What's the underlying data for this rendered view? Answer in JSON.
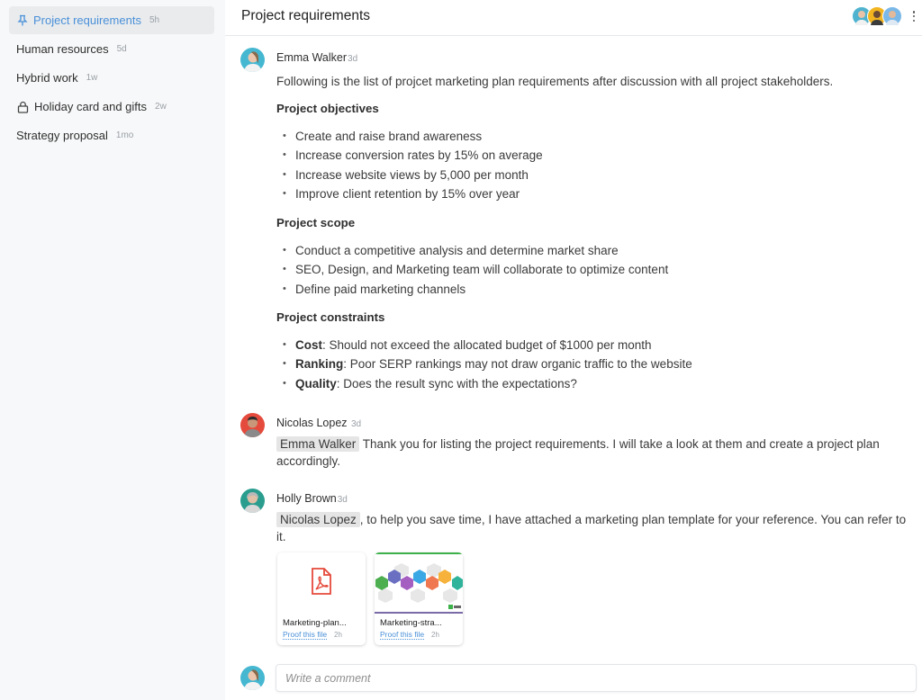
{
  "sidebar": {
    "items": [
      {
        "label": "Project requirements",
        "age": "5h",
        "icon": "pin-icon",
        "active": true
      },
      {
        "label": "Human resources",
        "age": "5d"
      },
      {
        "label": "Hybrid work",
        "age": "1w"
      },
      {
        "label": "Holiday card and gifts",
        "age": "2w",
        "icon": "lock-icon"
      },
      {
        "label": "Strategy proposal",
        "age": "1mo"
      }
    ]
  },
  "header": {
    "title": "Project requirements",
    "participants": [
      {
        "name": "participant-1",
        "color": "#4fb3cf"
      },
      {
        "name": "participant-2",
        "color": "#f2b51f"
      },
      {
        "name": "participant-3",
        "color": "#7ab8e8"
      }
    ]
  },
  "messages": [
    {
      "author": "Emma Walker",
      "time": "3d",
      "avatar_color": "#45b7d1",
      "intro": "Following is the list of projcet marketing plan requirements after discussion with all project stakeholders.",
      "sections": [
        {
          "heading": "Project objectives",
          "items": [
            "Create and raise brand awareness",
            "Increase conversion rates by 15% on average",
            "Increase website views by 5,000 per month",
            "Improve client retention by 15% over year"
          ]
        },
        {
          "heading": "Project scope",
          "items": [
            "Conduct a competitive analysis and determine market share",
            "SEO, Design, and Marketing team will collaborate to optimize content",
            "Define paid marketing channels"
          ]
        },
        {
          "heading": "Project constraints",
          "items": [
            {
              "bold": "Cost",
              "text": ": Should not exceed the allocated budget of $1000 per month"
            },
            {
              "bold": "Ranking",
              "text": ": Poor SERP rankings may not draw organic traffic to the website"
            },
            {
              "bold": "Quality",
              "text": ": Does the result sync with the expectations?"
            }
          ]
        }
      ]
    },
    {
      "author": "Nicolas Lopez",
      "time": "3d",
      "avatar_color": "#e54b3c",
      "mention": "Emma Walker",
      "text": " Thank you for listing the project requirements. I will take a look at them and create a project plan accordingly."
    },
    {
      "author": "Holly Brown",
      "time": "3d",
      "avatar_color": "#2a9d8f",
      "mention": "Nicolas Lopez",
      "text": ", to help you save time, I have attached a marketing plan template for your reference. You can refer to it.",
      "attachments": [
        {
          "name": "Marketing-plan...",
          "action": "Proof this file",
          "age": "2h",
          "type": "pdf-icon"
        },
        {
          "name": "Marketing-stra...",
          "action": "Proof this file",
          "age": "2h",
          "type": "image-thumbnail"
        }
      ]
    }
  ],
  "comment": {
    "placeholder": "Write a comment",
    "value": ""
  },
  "colors": {
    "accent": "#4a90d9",
    "pdf": "#e5493a"
  }
}
